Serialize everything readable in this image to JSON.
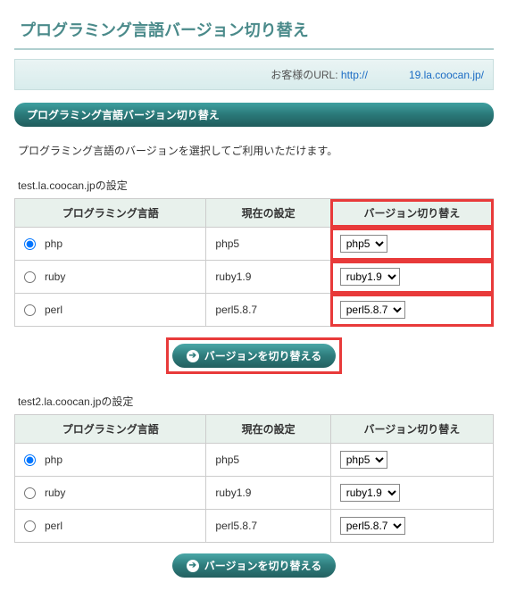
{
  "page_title": "プログラミング言語バージョン切り替え",
  "url_label": "お客様のURL:",
  "url_prefix": "http://",
  "url_suffix": "19.la.coocan.jp/",
  "section_heading": "プログラミング言語バージョン切り替え",
  "description": "プログラミング言語のバージョンを選択してご利用いただけます。",
  "headers": {
    "language": "プログラミング言語",
    "current": "現在の設定",
    "switch": "バージョン切り替え"
  },
  "submit_label": "バージョンを切り替える",
  "sections": [
    {
      "title": "test.la.coocan.jpの設定",
      "highlight": true,
      "rows": [
        {
          "language": "php",
          "current": "php5",
          "selected": "php5",
          "checked": true
        },
        {
          "language": "ruby",
          "current": "ruby1.9",
          "selected": "ruby1.9",
          "checked": false
        },
        {
          "language": "perl",
          "current": "perl5.8.7",
          "selected": "perl5.8.7",
          "checked": false
        }
      ]
    },
    {
      "title": "test2.la.coocan.jpの設定",
      "highlight": false,
      "rows": [
        {
          "language": "php",
          "current": "php5",
          "selected": "php5",
          "checked": true
        },
        {
          "language": "ruby",
          "current": "ruby1.9",
          "selected": "ruby1.9",
          "checked": false
        },
        {
          "language": "perl",
          "current": "perl5.8.7",
          "selected": "perl5.8.7",
          "checked": false
        }
      ]
    }
  ]
}
